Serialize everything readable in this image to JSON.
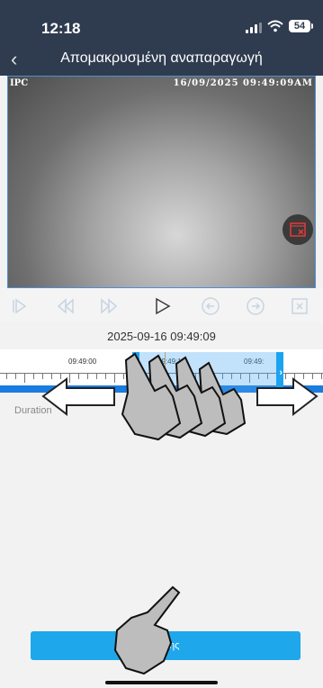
{
  "status_bar": {
    "time": "12:18",
    "battery": "54"
  },
  "nav": {
    "title": "Απομακρυσμένη αναπαραγωγή",
    "back_icon": "chevron-left-icon"
  },
  "video": {
    "channel_label": "IPC",
    "timestamp": "16/09/2025 09:49:09AM",
    "record_off_icon": "record-off-icon"
  },
  "controls": [
    "skip-to-start-icon",
    "rewind-icon",
    "fast-forward-icon",
    "play-icon",
    "previous-circle-icon",
    "next-circle-icon",
    "snapshot-icon"
  ],
  "playback": {
    "date_time": "2025-09-16 09:49:09"
  },
  "timeline": {
    "ticks": [
      "09:49:00",
      "09:49:10",
      "09:49:"
    ]
  },
  "details": {
    "duration_label": "Duration"
  },
  "save": {
    "label": "λήψης"
  },
  "colors": {
    "header": "#2f3b4f",
    "accent": "#1a7be0",
    "button": "#1fa7ec"
  }
}
